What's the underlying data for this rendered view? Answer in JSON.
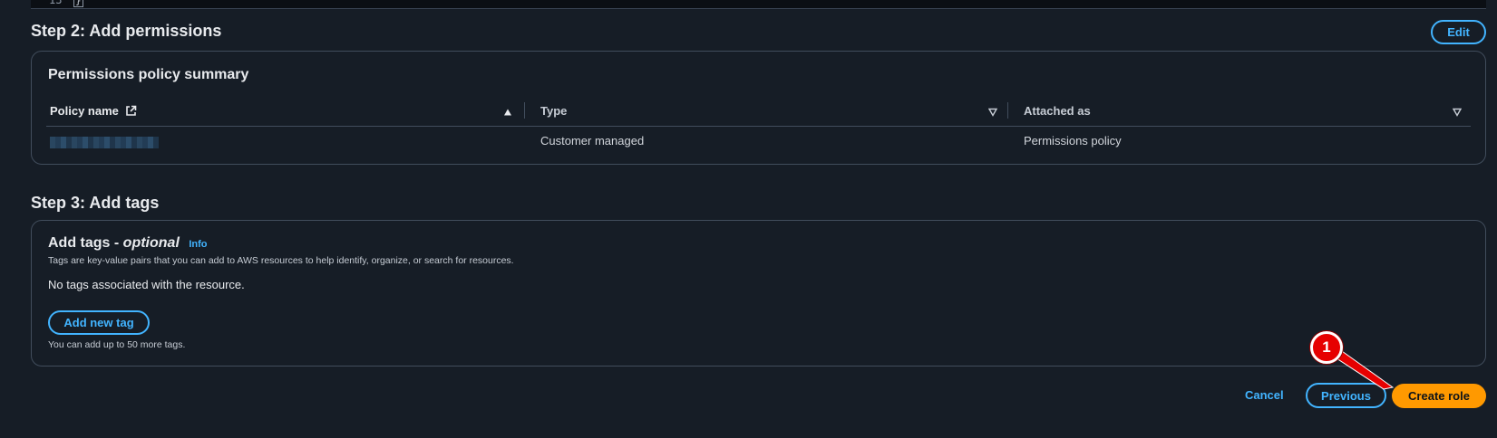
{
  "code_editor": {
    "line_number": "13",
    "cursor_text": "}"
  },
  "step2": {
    "heading": "Step 2: Add permissions",
    "edit_label": "Edit",
    "panel_title": "Permissions policy summary",
    "columns": [
      "Policy name",
      "Type",
      "Attached as"
    ],
    "rows": [
      {
        "policy_name_redacted": true,
        "type": "Customer managed",
        "attached_as": "Permissions policy"
      }
    ]
  },
  "step3": {
    "heading": "Step 3: Add tags",
    "panel_title": "Add tags - ",
    "panel_title_italic": "optional",
    "info_label": "Info",
    "description": "Tags are key-value pairs that you can add to AWS resources to help identify, organize, or search for resources.",
    "empty_text": "No tags associated with the resource.",
    "add_tag_label": "Add new tag",
    "limit_text": "You can add up to 50 more tags."
  },
  "footer": {
    "cancel_label": "Cancel",
    "previous_label": "Previous",
    "create_label": "Create role"
  },
  "annotation": {
    "number": "1",
    "color": "#e60000"
  }
}
